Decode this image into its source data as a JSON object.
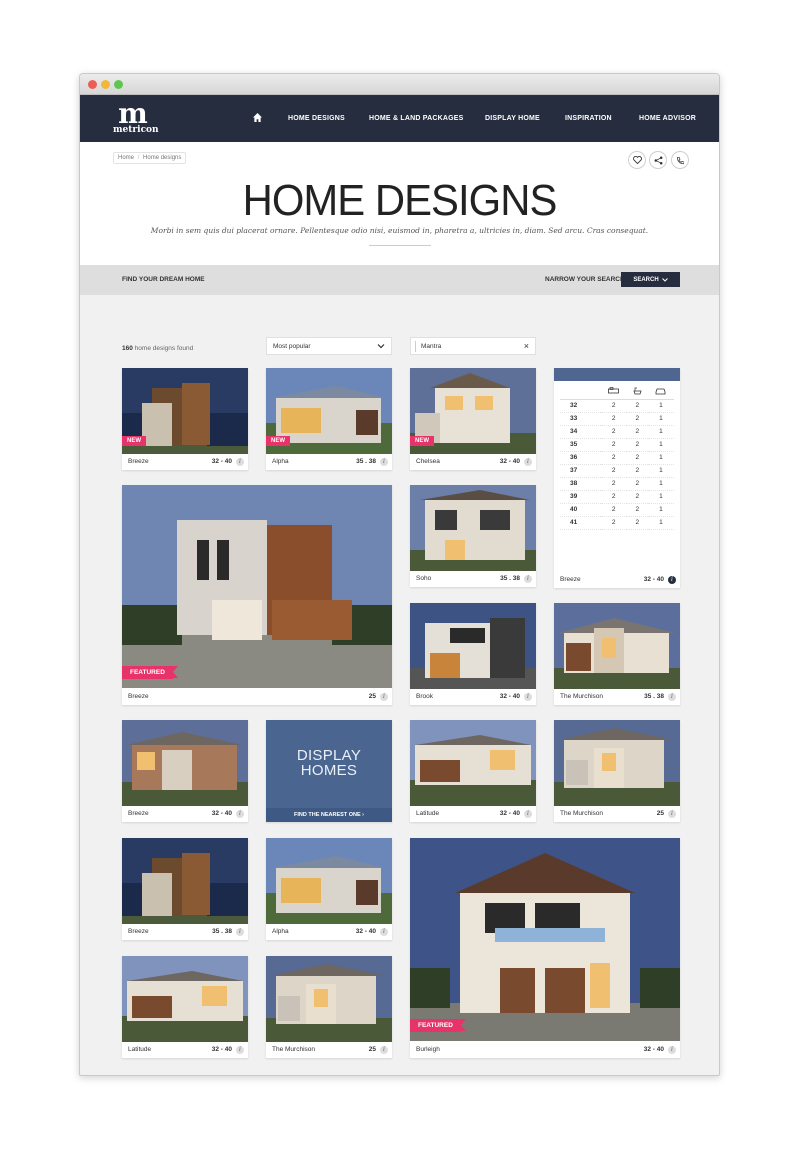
{
  "nav": {
    "logo_mark": "m",
    "logo_word": "metricon",
    "items": [
      "HOME DESIGNS",
      "HOME & LAND PACKAGES",
      "DISPLAY HOME",
      "INSPIRATION",
      "HOME ADVISOR"
    ]
  },
  "breadcrumb": {
    "home": "Home",
    "separator": "/",
    "current": "Home designs"
  },
  "header": {
    "title": "HOME DESIGNS",
    "subtitle": "Morbi in sem quis dui placerat ornare. Pellentesque odio nisi, euismod in, pharetra a, ultricies in, diam. Sed arcu. Cras consequat."
  },
  "search_bar": {
    "find_label": "FIND YOUR DREAM HOME",
    "narrow_label": "NARROW YOUR SEARCH",
    "search_button": "SEARCH"
  },
  "results": {
    "count": "160",
    "suffix": "home designs found"
  },
  "sort": {
    "value": "Most popular"
  },
  "filter": {
    "value": "Mantra"
  },
  "cards": [
    {
      "name": "Breeze",
      "size": "32 - 40",
      "badge": "NEW",
      "icon": "info-icon"
    },
    {
      "name": "Alpha",
      "size": "35 . 38",
      "badge": "NEW",
      "icon": "info-icon"
    },
    {
      "name": "Chelsea",
      "size": "32 - 40",
      "badge": "NEW",
      "icon": "info-icon"
    },
    {
      "name": "Breeze",
      "size": "25",
      "badge": "FEATURED",
      "icon": "info-icon"
    },
    {
      "name": "Soho",
      "size": "35 . 38",
      "icon": "info-icon"
    },
    {
      "name": "Brook",
      "size": "32 - 40",
      "icon": "info-icon"
    },
    {
      "name": "The Murchison",
      "size": "35 . 38",
      "icon": "info-icon"
    },
    {
      "name": "Breeze",
      "size": "32 - 40",
      "icon": "info-icon"
    },
    {
      "name": "Latitude",
      "size": "32 - 40",
      "icon": "info-icon"
    },
    {
      "name": "The Murchison",
      "size": "25",
      "icon": "info-icon"
    },
    {
      "name": "Breeze",
      "size": "35 . 38",
      "icon": "info-icon"
    },
    {
      "name": "Alpha",
      "size": "32 - 40",
      "icon": "info-icon"
    },
    {
      "name": "Burleigh",
      "size": "32 - 40",
      "badge": "FEATURED",
      "icon": "info-icon"
    },
    {
      "name": "Latitude",
      "size": "32 - 40",
      "icon": "info-icon"
    },
    {
      "name": "The Murchison",
      "size": "25",
      "icon": "info-icon"
    }
  ],
  "spec_table": {
    "name": "Breeze",
    "size": "32 - 40",
    "column_icons": [
      "bed-icon",
      "bath-icon",
      "car-icon"
    ],
    "rows": [
      [
        "32",
        "2",
        "2",
        "1"
      ],
      [
        "33",
        "2",
        "2",
        "1"
      ],
      [
        "34",
        "2",
        "2",
        "1"
      ],
      [
        "35",
        "2",
        "2",
        "1"
      ],
      [
        "36",
        "2",
        "2",
        "1"
      ],
      [
        "37",
        "2",
        "2",
        "1"
      ],
      [
        "38",
        "2",
        "2",
        "1"
      ],
      [
        "39",
        "2",
        "2",
        "1"
      ],
      [
        "40",
        "2",
        "2",
        "1"
      ],
      [
        "41",
        "2",
        "2",
        "1"
      ]
    ]
  },
  "display_card": {
    "line1": "DISPLAY",
    "line2": "HOMES",
    "cta": "FIND THE NEAREST ONE"
  },
  "colors": {
    "navbar": "#262d3e",
    "badge": "#e8336a",
    "display": "#4a6690"
  }
}
